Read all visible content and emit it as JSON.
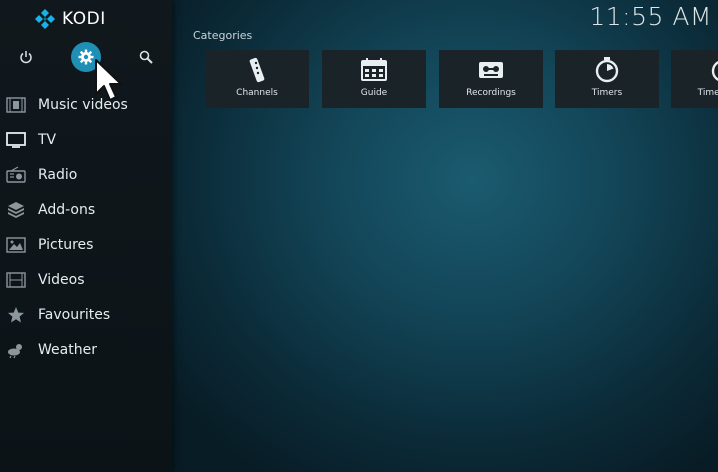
{
  "app": {
    "logo_text": "KODI"
  },
  "clock": "11:55 AM",
  "sidebar": {
    "items": [
      {
        "label": "Music videos",
        "icon": "music-video-icon"
      },
      {
        "label": "TV",
        "icon": "tv-icon"
      },
      {
        "label": "Radio",
        "icon": "radio-icon"
      },
      {
        "label": "Add-ons",
        "icon": "addons-icon"
      },
      {
        "label": "Pictures",
        "icon": "pictures-icon"
      },
      {
        "label": "Videos",
        "icon": "videos-icon"
      },
      {
        "label": "Favourites",
        "icon": "star-icon"
      },
      {
        "label": "Weather",
        "icon": "weather-icon"
      }
    ]
  },
  "categories": {
    "title": "Categories",
    "tiles": [
      {
        "label": "Channels",
        "icon": "remote-icon"
      },
      {
        "label": "Guide",
        "icon": "guide-icon"
      },
      {
        "label": "Recordings",
        "icon": "recordings-icon"
      },
      {
        "label": "Timers",
        "icon": "timer-icon"
      },
      {
        "label": "Timer rules",
        "icon": "timer-rules-icon"
      }
    ]
  },
  "colors": {
    "accent": "#1f8fb5",
    "logo_blue": "#17b2e8"
  }
}
